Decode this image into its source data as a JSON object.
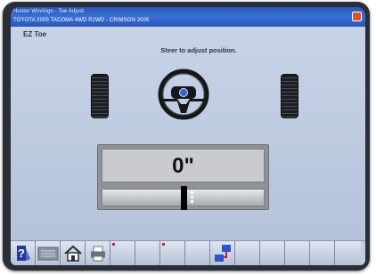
{
  "window": {
    "title": "Hunter WinAlign - Toe Adjust",
    "subtitle": "TOYOTA 2005 TACOMA 4WD R2WD - CRIMSON 2005"
  },
  "screen": {
    "title": "EZ Toe",
    "instruction": "Steer to adjust position."
  },
  "gauge": {
    "value_text": "0\"",
    "needle_fraction": 0.5
  },
  "actions": {
    "confirm_icon": "check-icon",
    "cancel_icon": "x-icon",
    "confirm_color": "#2eaa1f",
    "cancel_color": "#d81e1e"
  },
  "toolbar": {
    "buttons": [
      "help-icon",
      "keyboard-icon",
      "home-icon",
      "printer-icon",
      "blank",
      "blank",
      "blank",
      "blank",
      "network-icon",
      "blank",
      "blank",
      "blank",
      "blank",
      "blank"
    ]
  },
  "colors": {
    "title_bar": "#2857b8",
    "screen_bg": "#bac8de",
    "wheel_accent": "#3463d1"
  }
}
